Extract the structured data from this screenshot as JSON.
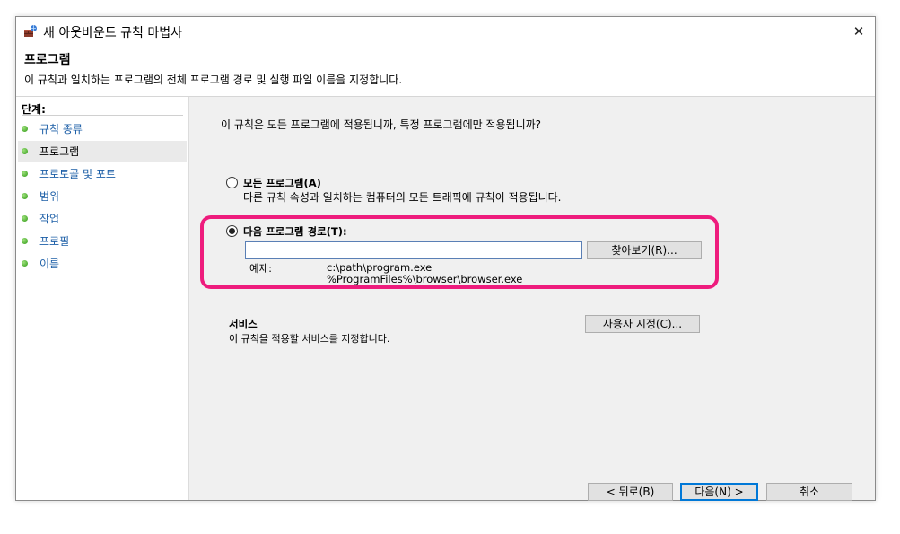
{
  "window": {
    "title": "새 아웃바운드 규칙 마법사",
    "close_glyph": "✕"
  },
  "header": {
    "title": "프로그램",
    "description": "이 규칙과 일치하는 프로그램의 전체 프로그램 경로 및 실행 파일 이름을 지정합니다."
  },
  "sidebar": {
    "steps_label": "단계:",
    "steps": [
      {
        "label": "규칙 종류",
        "current": false
      },
      {
        "label": "프로그램",
        "current": true
      },
      {
        "label": "프로토콜 및 포트",
        "current": false
      },
      {
        "label": "범위",
        "current": false
      },
      {
        "label": "작업",
        "current": false
      },
      {
        "label": "프로필",
        "current": false
      },
      {
        "label": "이름",
        "current": false
      }
    ]
  },
  "content": {
    "question": "이 규칙은 모든 프로그램에 적용됩니까, 특정 프로그램에만 적용됩니까?",
    "all_programs": {
      "label": "모든 프로그램(A)",
      "description": "다른 규칙 속성과 일치하는 컴퓨터의 모든 트래픽에 규칙이 적용됩니다.",
      "selected": false
    },
    "program_path": {
      "label": "다음 프로그램 경로(T):",
      "selected": true,
      "value": "",
      "browse_label": "찾아보기(R)...",
      "example_label": "예제:",
      "example_lines": [
        "c:\\path\\program.exe",
        "%ProgramFiles%\\browser\\browser.exe"
      ]
    },
    "services": {
      "title": "서비스",
      "description": "이 규칙을 적용할 서비스를 지정합니다.",
      "customize_label": "사용자 지정(C)..."
    }
  },
  "footer": {
    "back_label": "< 뒤로(B)",
    "next_label": "다음(N) >",
    "cancel_label": "취소"
  },
  "colors": {
    "highlight": "#ee1c7d",
    "step_link": "#1d5fa7",
    "primary_border": "#0078d7"
  }
}
